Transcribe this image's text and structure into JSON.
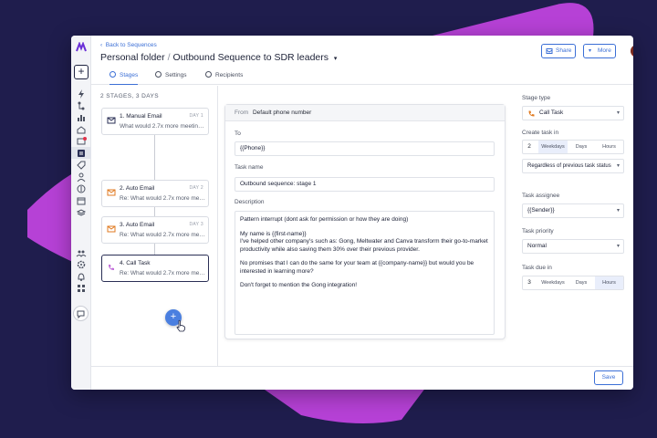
{
  "header": {
    "back_label": "Back to Sequences",
    "folder": "Personal folder",
    "sequence_name": "Outbound Sequence to SDR leaders",
    "share_label": "Share",
    "more_label": "More"
  },
  "tabs": [
    {
      "label": "Stages"
    },
    {
      "label": "Settings"
    },
    {
      "label": "Recipients"
    }
  ],
  "stages_summary": "2 STAGES, 3 DAYS",
  "stages": [
    {
      "name": "1. Manual Email",
      "day": "DAY 1",
      "subtitle": "What would 2.7x more meetings..."
    },
    {
      "name": "2. Auto Email",
      "day": "DAY 2",
      "subtitle": "Re: What would 2.7x more meet..."
    },
    {
      "name": "3. Auto Email",
      "day": "DAY 3",
      "subtitle": "Re: What would 2.7x more meet..."
    },
    {
      "name": "4. Call Task",
      "day": "",
      "subtitle": "Re: What would 2.7x more meet..."
    }
  ],
  "task": {
    "from_label": "From",
    "from_value": "Default phone number",
    "to_label": "To",
    "to_value": "{{Phone}}",
    "name_label": "Task name",
    "name_value": "Outbound sequence: stage 1",
    "description_label": "Description",
    "description": [
      "Pattern interrupt (dont ask for permission or how they are doing)",
      "My name is {{first-name}}",
      "I've helped other company's such as: Gong, Meltwater and Canva transform their go-to-market productivity while also saving them 30% over their previous provider.",
      "No promises that I can do the same for your team at {{company-name}} but would you be interested in learning more?",
      "Don't forget to mention the Gong integration!"
    ]
  },
  "settings": {
    "stage_type_label": "Stage type",
    "stage_type_value": "Call Task",
    "create_task_label": "Create task in",
    "create_task_number": "2",
    "create_task_units": [
      "Weekdays",
      "Days",
      "Hours"
    ],
    "create_task_selected": "Weekdays",
    "condition_value": "Regardless of previous task status",
    "assignee_label": "Task assignee",
    "assignee_value": "{{Sender}}",
    "priority_label": "Task priority",
    "priority_value": "Normal",
    "due_label": "Task due in",
    "due_number": "3",
    "due_units": [
      "Weekdays",
      "Days",
      "Hours"
    ],
    "due_selected": "Hours"
  },
  "footer": {
    "save_label": "Save"
  },
  "colors": {
    "background": "#1f1d4d",
    "blob": "#b641d6",
    "accent": "#3b6fd6",
    "add_button": "#4a7fe0"
  }
}
